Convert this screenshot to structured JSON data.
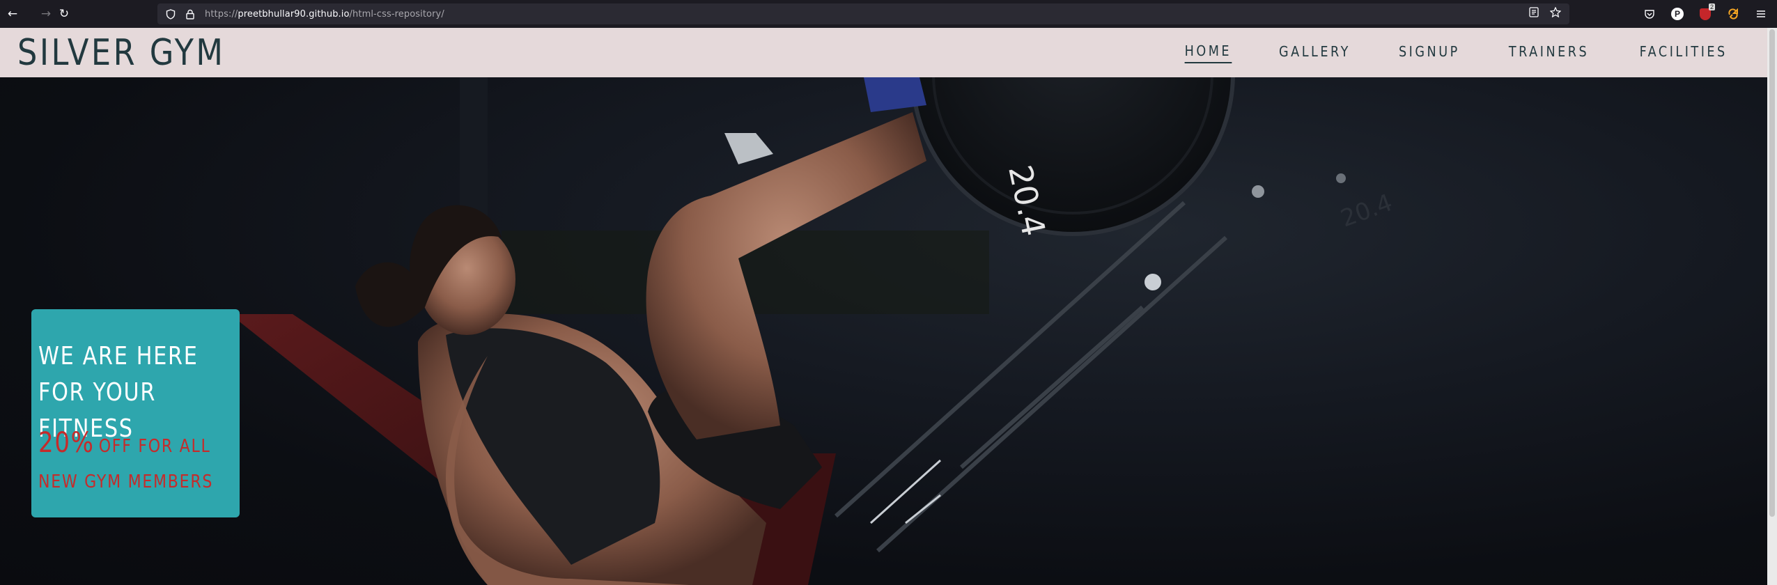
{
  "browser": {
    "url_scheme": "https://",
    "url_host": "preetbhullar90.github.io",
    "url_path": "/html-css-repository/",
    "icons": [
      "back-arrow-icon",
      "forward-arrow-icon",
      "reload-icon",
      "shield-icon",
      "lock-icon",
      "reader-view-icon",
      "bookmark-star-icon",
      "pocket-icon",
      "profile-icon",
      "ublock-icon",
      "extension-icon",
      "menu-icon"
    ],
    "extension_badge": "2"
  },
  "site": {
    "logo": "SILVER GYM",
    "nav": [
      {
        "label": "HOME",
        "active": true
      },
      {
        "label": "GALLERY",
        "active": false
      },
      {
        "label": "SIGNUP",
        "active": false
      },
      {
        "label": "TRAINERS",
        "active": false
      },
      {
        "label": "FACILITIES",
        "active": false
      }
    ]
  },
  "hero": {
    "plate_text": "20.4",
    "plate_text_secondary": "20.4",
    "promo": {
      "title": "WE ARE HERE FOR YOUR FITNESS",
      "percent": "20%",
      "offer": "OFF FOR ALL NEW GYM MEMBERS"
    }
  },
  "colors": {
    "header_bg": "#e5d9da",
    "brand_text": "#22393f",
    "promo_bg": "#2ea6ad",
    "promo_accent": "#c52b2b"
  }
}
